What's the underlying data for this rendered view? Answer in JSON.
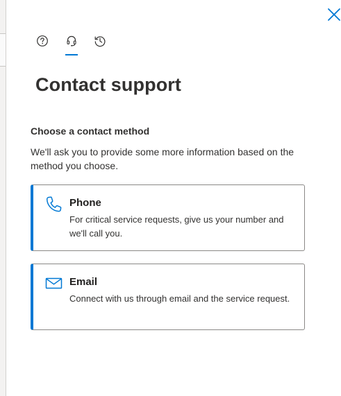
{
  "header": {
    "close_label": "Close"
  },
  "tabs": [
    {
      "name": "help",
      "icon": "help-icon",
      "active": false
    },
    {
      "name": "contact-support",
      "icon": "headset-icon",
      "active": true
    },
    {
      "name": "history",
      "icon": "history-icon",
      "active": false
    }
  ],
  "page": {
    "title": "Contact support"
  },
  "contact": {
    "heading": "Choose a contact method",
    "description": "We'll ask you to provide some more information based on the method you choose.",
    "methods": [
      {
        "icon": "phone-icon",
        "title": "Phone",
        "description": "For critical service requests, give us your number and we'll call you."
      },
      {
        "icon": "mail-icon",
        "title": "Email",
        "description": "Connect with us through email and the service request."
      }
    ]
  },
  "colors": {
    "accent": "#0078d4",
    "text": "#323130",
    "border": "#8a8886"
  }
}
